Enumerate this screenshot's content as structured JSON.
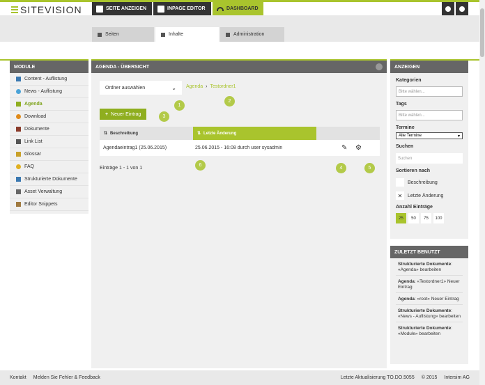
{
  "brand": {
    "name": "SITEVISION"
  },
  "topnav": {
    "seite_anzeigen": "SEITE ANZEIGEN",
    "inpage_editor": "INPAGE EDITOR",
    "dashboard": "DASHBOARD"
  },
  "subtabs": [
    {
      "label": "Seiten"
    },
    {
      "label": "Inhalte"
    },
    {
      "label": "Administration"
    }
  ],
  "sidebar": {
    "title": "MODULE",
    "items": [
      {
        "label": "Content - Auflistung",
        "icon": "list-icon"
      },
      {
        "label": "News - Auflistung",
        "icon": "news-icon"
      },
      {
        "label": "Agenda",
        "icon": "calendar-icon"
      },
      {
        "label": "Download",
        "icon": "download-icon"
      },
      {
        "label": "Dokumente",
        "icon": "document-icon"
      },
      {
        "label": "Link List",
        "icon": "link-icon"
      },
      {
        "label": "Glossar",
        "icon": "glossary-icon"
      },
      {
        "label": "FAQ",
        "icon": "faq-icon"
      },
      {
        "label": "Strukturierte Dokumente",
        "icon": "structured-doc-icon"
      },
      {
        "label": "Asset Verwaltung",
        "icon": "asset-icon"
      },
      {
        "label": "Editor Snippets",
        "icon": "snippet-icon"
      }
    ]
  },
  "main": {
    "title": "AGENDA - ÜBERSICHT",
    "folder_select": "Ordner auswählen",
    "breadcrumb": [
      "Agenda",
      "Testordner1"
    ],
    "new_entry": "Neuer Eintrag",
    "table": {
      "headers": [
        "Beschreibung",
        "Letzte Änderung"
      ],
      "rows": [
        {
          "beschreibung": "Agendaeintrag1 (25.06.2015)",
          "letzte_aenderung": "25.06.2015 - 16:08 durch user sysadmin"
        }
      ]
    },
    "page_info": "Einträge 1 - 1 von 1"
  },
  "markers": [
    "1",
    "2",
    "3",
    "4",
    "5",
    "6"
  ],
  "right": {
    "title": "ANZEIGEN",
    "kategorien": "Kategorien",
    "kategorien_placeholder": "Bitte wählen...",
    "tags": "Tags",
    "tags_placeholder": "Bitte wählen...",
    "termine": "Termine",
    "termine_value": "Alle Termine",
    "suchen": "Suchen",
    "suchen_placeholder": "Suchen",
    "sortieren": "Sortieren nach",
    "sort_options": [
      "Beschreibung",
      "Letzte Änderung"
    ],
    "anzahl": "Anzahl Einträge",
    "counts": [
      "25",
      "50",
      "75",
      "100"
    ]
  },
  "recent": {
    "title": "ZULETZT BENUTZT",
    "items": [
      {
        "bold": "Strukturierte Dokumente",
        "rest": ": «Agenda» bearbeiten"
      },
      {
        "bold": "Agenda",
        "rest": ": «Testordner1» Neuer Eintrag"
      },
      {
        "bold": "Agenda",
        "rest": ": «root» Neuer Eintrag"
      },
      {
        "bold": "Strukturierte Dokumente",
        "rest": ": «News - Auflistung» bearbeiten"
      },
      {
        "bold": "Strukturierte Dokumente",
        "rest": ": «Module» bearbeiten"
      }
    ]
  },
  "footer": {
    "kontakt": "Kontakt",
    "feedback": "Melden Sie Fehler & Feedback",
    "update": "Letzte Aktualisierung TO.DO.5055",
    "copyright": "© 2015",
    "company": "Intersim AG"
  },
  "colors": {
    "accent": "#a9c42d",
    "dark": "#333333",
    "panel": "#666666"
  }
}
